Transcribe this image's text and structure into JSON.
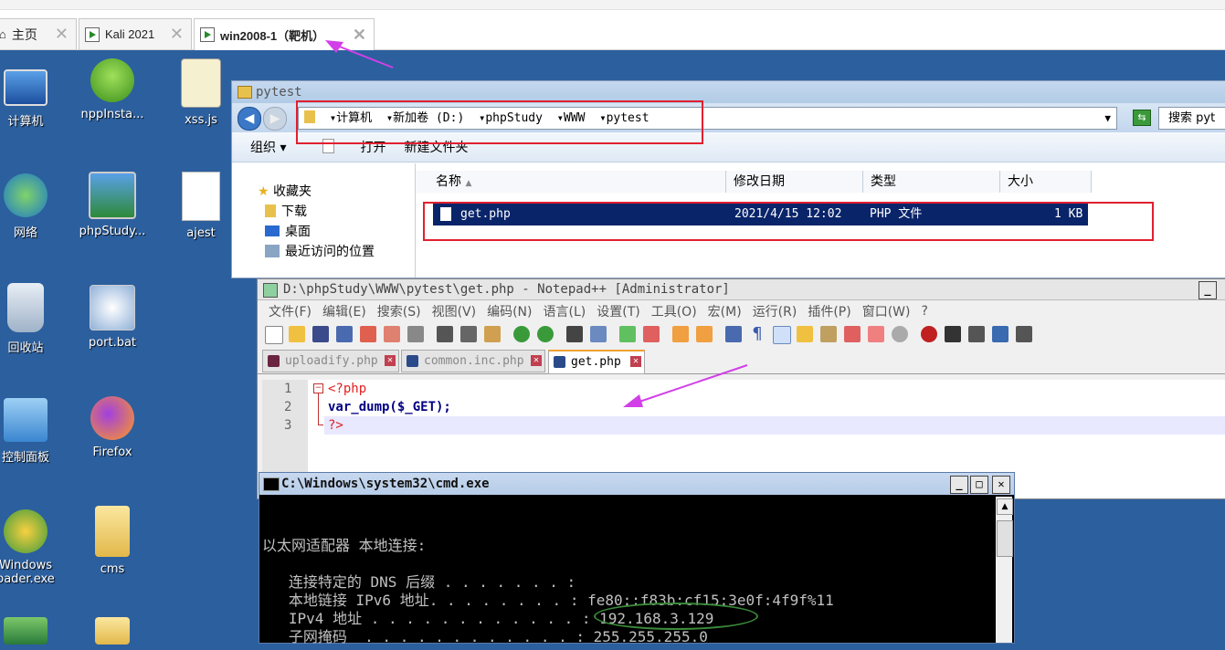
{
  "vm_tabs": [
    {
      "label": "主页",
      "active": false
    },
    {
      "label": "Kali 2021",
      "active": false
    },
    {
      "label": "win2008-1（靶机）",
      "active": true
    }
  ],
  "desktop_icons": [
    {
      "label": "计算机",
      "icon": "computer-icon"
    },
    {
      "label": "nppInsta...",
      "icon": "installer-icon"
    },
    {
      "label": "xss.js",
      "icon": "script-file-icon"
    },
    {
      "label": "网络",
      "icon": "network-icon"
    },
    {
      "label": "phpStudy...",
      "icon": "shortcut-icon"
    },
    {
      "label": "ajest",
      "icon": "blank-file-icon"
    },
    {
      "label": "回收站",
      "icon": "recycle-bin-icon"
    },
    {
      "label": "port.bat",
      "icon": "batch-file-icon"
    },
    {
      "label": "控制面板",
      "icon": "control-panel-icon"
    },
    {
      "label": "Firefox",
      "icon": "firefox-icon"
    },
    {
      "label": "Windows\noader.exe",
      "icon": "windows-loader-icon"
    },
    {
      "label": "cms",
      "icon": "folder-icon"
    }
  ],
  "explorer": {
    "title": "pytest",
    "breadcrumb": [
      "计算机",
      "新加卷 (D:)",
      "phpStudy",
      "WWW",
      "pytest"
    ],
    "search_placeholder": "搜索 pyt",
    "commands": {
      "organize": "组织 ▾",
      "open": "打开",
      "new_folder": "新建文件夹"
    },
    "nav": {
      "favorites": "收藏夹",
      "downloads": "下载",
      "desktop": "桌面",
      "recent": "最近访问的位置"
    },
    "columns": {
      "name": "名称",
      "modified": "修改日期",
      "type": "类型",
      "size": "大小"
    },
    "files": [
      {
        "name": "get.php",
        "modified": "2021/4/15 12:02",
        "type": "PHP 文件",
        "size": "1 KB"
      }
    ]
  },
  "notepad": {
    "title": "D:\\phpStudy\\WWW\\pytest\\get.php - Notepad++ [Administrator]",
    "menu": [
      "文件(F)",
      "编辑(E)",
      "搜索(S)",
      "视图(V)",
      "编码(N)",
      "语言(L)",
      "设置(T)",
      "工具(O)",
      "宏(M)",
      "运行(R)",
      "插件(P)",
      "窗口(W)",
      "?"
    ],
    "tabs": [
      {
        "label": "uploadify.php",
        "active": false
      },
      {
        "label": "common.inc.php",
        "active": false
      },
      {
        "label": "get.php",
        "active": true
      }
    ],
    "lines": [
      {
        "num": "1",
        "text": "<?php"
      },
      {
        "num": "2",
        "text": "var_dump($_GET);"
      },
      {
        "num": "3",
        "text": "?>"
      }
    ]
  },
  "cmd": {
    "title": "C:\\Windows\\system32\\cmd.exe",
    "lines": [
      "以太网适配器 本地连接:",
      "   连接特定的 DNS 后缀 . . . . . . . :",
      "   本地链接 IPv6 地址. . . . . . . . : fe80::f83b:cf15:3e0f:4f9f%11",
      "   IPv4 地址 . . . . . . . . . . . . : 192.168.3.129",
      "   子网掩码  . . . . . . . . . . . . : 255.255.255.0"
    ]
  },
  "colors": {
    "desktop_bg": "#2c5f9e",
    "annotation_red": "#e02030",
    "annotation_purple": "#d23fe8",
    "annotation_green": "#3a8a3a",
    "selection": "#0a246a"
  }
}
